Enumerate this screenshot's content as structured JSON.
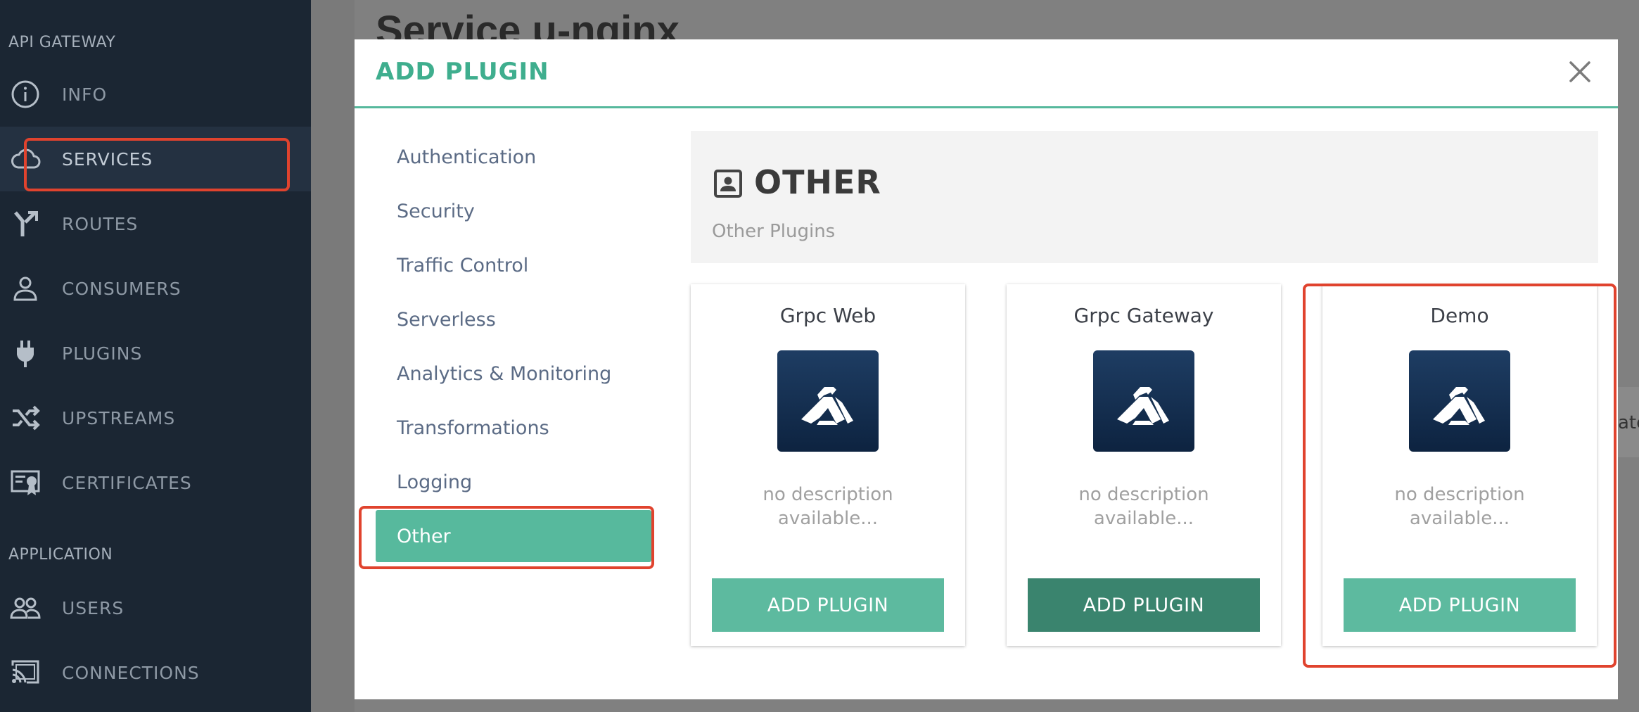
{
  "sidebar": {
    "sections": [
      "API GATEWAY",
      "APPLICATION"
    ],
    "items": [
      {
        "label": "INFO",
        "icon": "info-icon"
      },
      {
        "label": "SERVICES",
        "icon": "cloud-icon",
        "active": true
      },
      {
        "label": "ROUTES",
        "icon": "route-fork-icon"
      },
      {
        "label": "CONSUMERS",
        "icon": "person-icon"
      },
      {
        "label": "PLUGINS",
        "icon": "plug-icon"
      },
      {
        "label": "UPSTREAMS",
        "icon": "shuffle-icon"
      },
      {
        "label": "CERTIFICATES",
        "icon": "certificate-icon"
      },
      {
        "label": "USERS",
        "icon": "users-icon"
      },
      {
        "label": "CONNECTIONS",
        "icon": "cast-icon"
      }
    ]
  },
  "background": {
    "page_title": "Service u-nginx",
    "partial_text": "ate"
  },
  "modal": {
    "title": "ADD PLUGIN",
    "close_icon": "close-icon",
    "categories": [
      {
        "label": "Authentication"
      },
      {
        "label": "Security"
      },
      {
        "label": "Traffic Control"
      },
      {
        "label": "Serverless"
      },
      {
        "label": "Analytics & Monitoring"
      },
      {
        "label": "Transformations"
      },
      {
        "label": "Logging"
      },
      {
        "label": "Other",
        "active": true
      }
    ],
    "group": {
      "icon": "contact-card-icon",
      "title": "OTHER",
      "subtitle": "Other Plugins"
    },
    "plugins": [
      {
        "name": "Grpc Web",
        "description": "no description available...",
        "button": "ADD PLUGIN"
      },
      {
        "name": "Grpc Gateway",
        "description": "no description available...",
        "button": "ADD PLUGIN",
        "hovered": true
      },
      {
        "name": "Demo",
        "description": "no description available...",
        "button": "ADD PLUGIN",
        "highlighted": true
      }
    ]
  },
  "colors": {
    "sidebar_bg": "#1b2633",
    "accent": "#57b99d",
    "accent_dark": "#3a846e",
    "highlight": "#e0432e"
  }
}
